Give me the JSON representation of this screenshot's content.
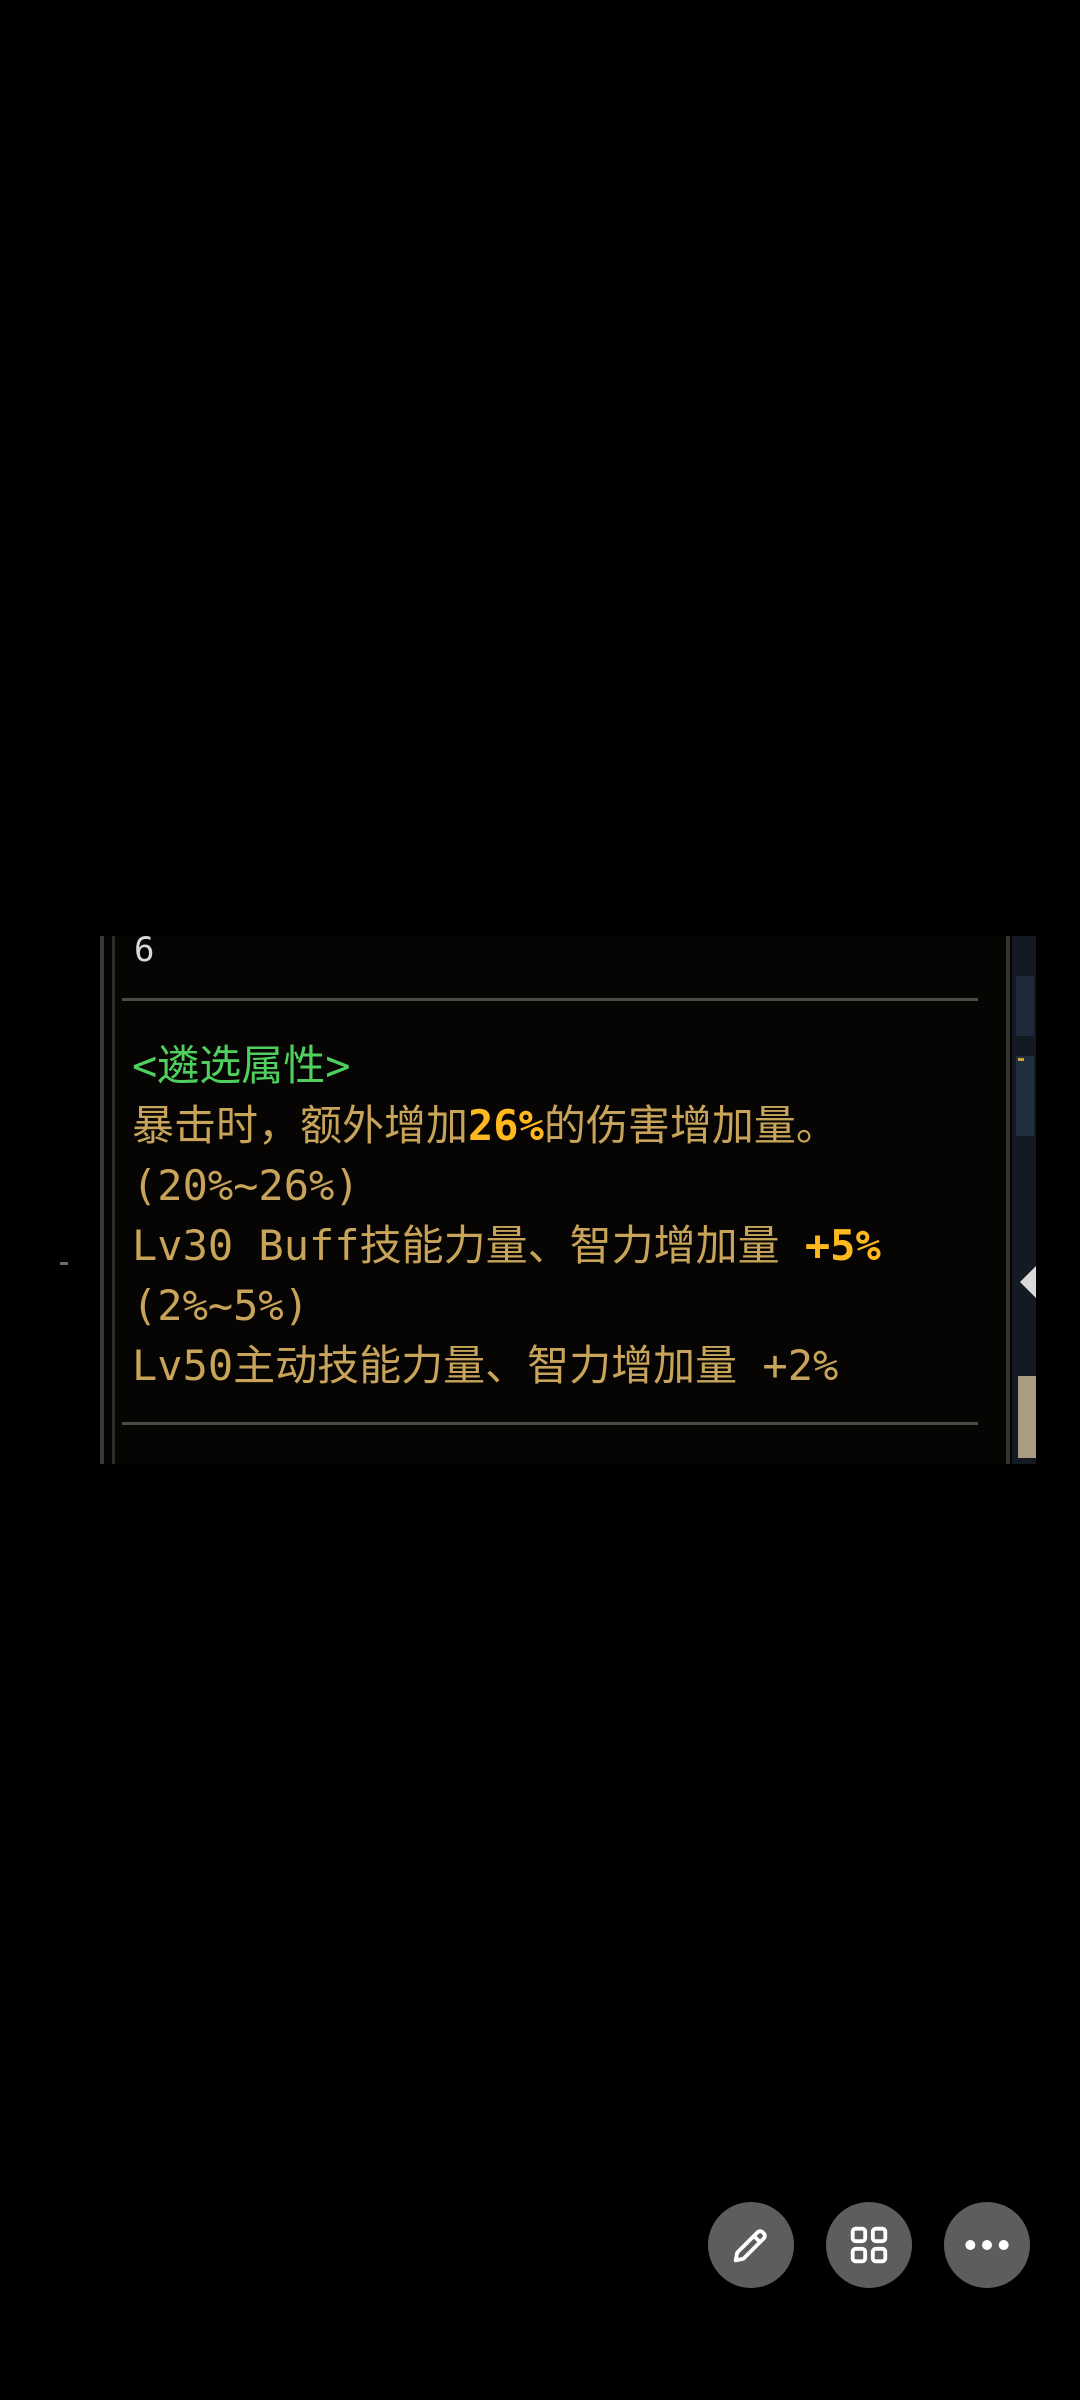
{
  "tooltip": {
    "partial_top_char": "6",
    "section_title": "<遴选属性>",
    "line1_prefix": "暴击时，额外增加",
    "line1_highlight": "26%",
    "line1_suffix": "的伤害增加量。",
    "line2": "(20%~26%)",
    "line3_prefix": "Lv30 Buff技能力量、智力增加量 ",
    "line3_highlight": "+5%",
    "line4": "(2%~5%)",
    "line5": "Lv50主动技能力量、智力增加量 +2%"
  },
  "actions": {
    "edit_icon": "pencil-icon",
    "grid_icon": "grid-icon",
    "more_icon": "more-dots-icon"
  },
  "colors": {
    "title_green": "#4fcf5e",
    "text_gold": "#c8a45a",
    "highlight_orange": "#ffb81e",
    "fab_bg": "#5d5d5d"
  }
}
